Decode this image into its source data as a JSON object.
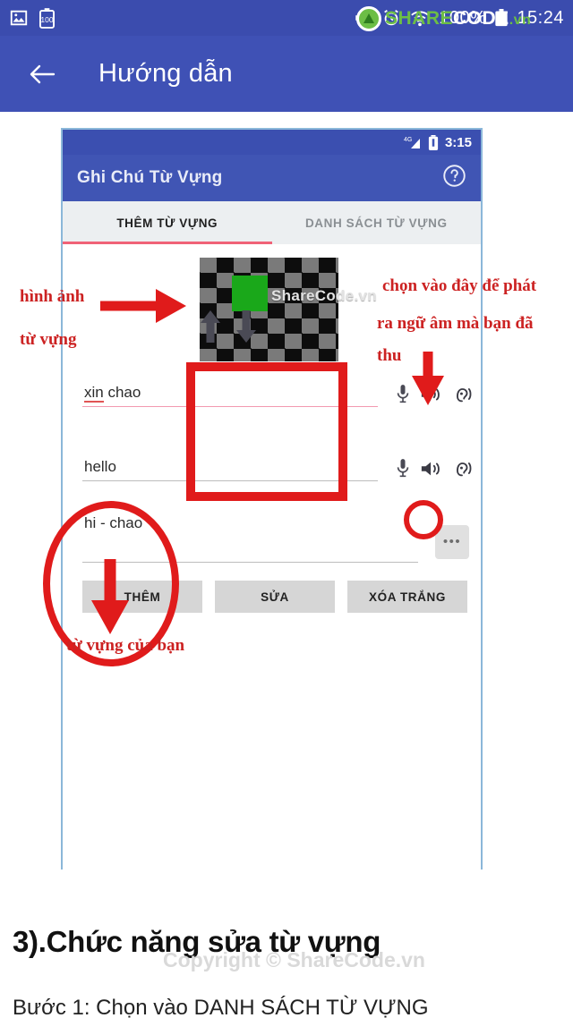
{
  "os_status_bar": {
    "left_icons": [
      "image-icon",
      "battery-saver-icon"
    ],
    "battery_badge": "100",
    "right_icons": [
      "mute-icon",
      "alarm-icon",
      "wifi-icon"
    ],
    "battery_percent": "100%",
    "time": "15:24"
  },
  "watermark": {
    "logo_a": "SHARE",
    "logo_b": "CODE",
    "logo_c": ".vn",
    "image_text": "ShareCode.vn",
    "copyright": "Copyright © ShareCode.vn"
  },
  "appbar": {
    "back_label": "back-arrow",
    "title": "Hướng dẫn"
  },
  "screenshot": {
    "status_bar": {
      "network": "4G",
      "time": "3:15"
    },
    "app_title": "Ghi Chú Từ Vựng",
    "help_label": "?",
    "tabs": [
      {
        "label": "THÊM TỪ VỰNG",
        "active": true
      },
      {
        "label": "DANH SÁCH TỪ VỰNG",
        "active": false
      }
    ],
    "image_preview": {
      "alt": "checkerboard-thumbnail"
    },
    "fields": [
      {
        "value": "xin chao",
        "misspelled": "xin",
        "rest": " chao",
        "underline": "pink"
      },
      {
        "value": "hello",
        "underline": "gray"
      },
      {
        "value": "hi - chao",
        "underline": "gray"
      }
    ],
    "field_icons": [
      "microphone-icon",
      "speaker-icon",
      "ear-listen-icon"
    ],
    "reorder_icons": [
      "arrow-up-icon",
      "arrow-down-icon"
    ],
    "overflow_label": "•••",
    "buttons": [
      {
        "label": "THÊM"
      },
      {
        "label": "SỬA"
      },
      {
        "label": "XÓA TRẮNG"
      }
    ]
  },
  "annotations": {
    "left_l1": "hình ảnh",
    "left_l2": "từ vựng",
    "right_l1": "chọn vào đây để phát",
    "right_l2": "ra ngữ âm mà bạn đã",
    "right_l3": "thu",
    "bottom": "từ vựng của bạn"
  },
  "page": {
    "section_heading": "3).Chức năng sửa từ vựng",
    "step_text": "Bước 1: Chọn vào DANH SÁCH TỪ VỰNG"
  },
  "colors": {
    "appbar_blue": "#3f51b5",
    "statusbar_blue": "#3b4cae",
    "annotation_red": "#cc2222",
    "shape_red": "#e01b1b",
    "accent_pink": "#f06277",
    "green_swatch": "#1aa81a",
    "brand_green": "#6cbe45"
  }
}
